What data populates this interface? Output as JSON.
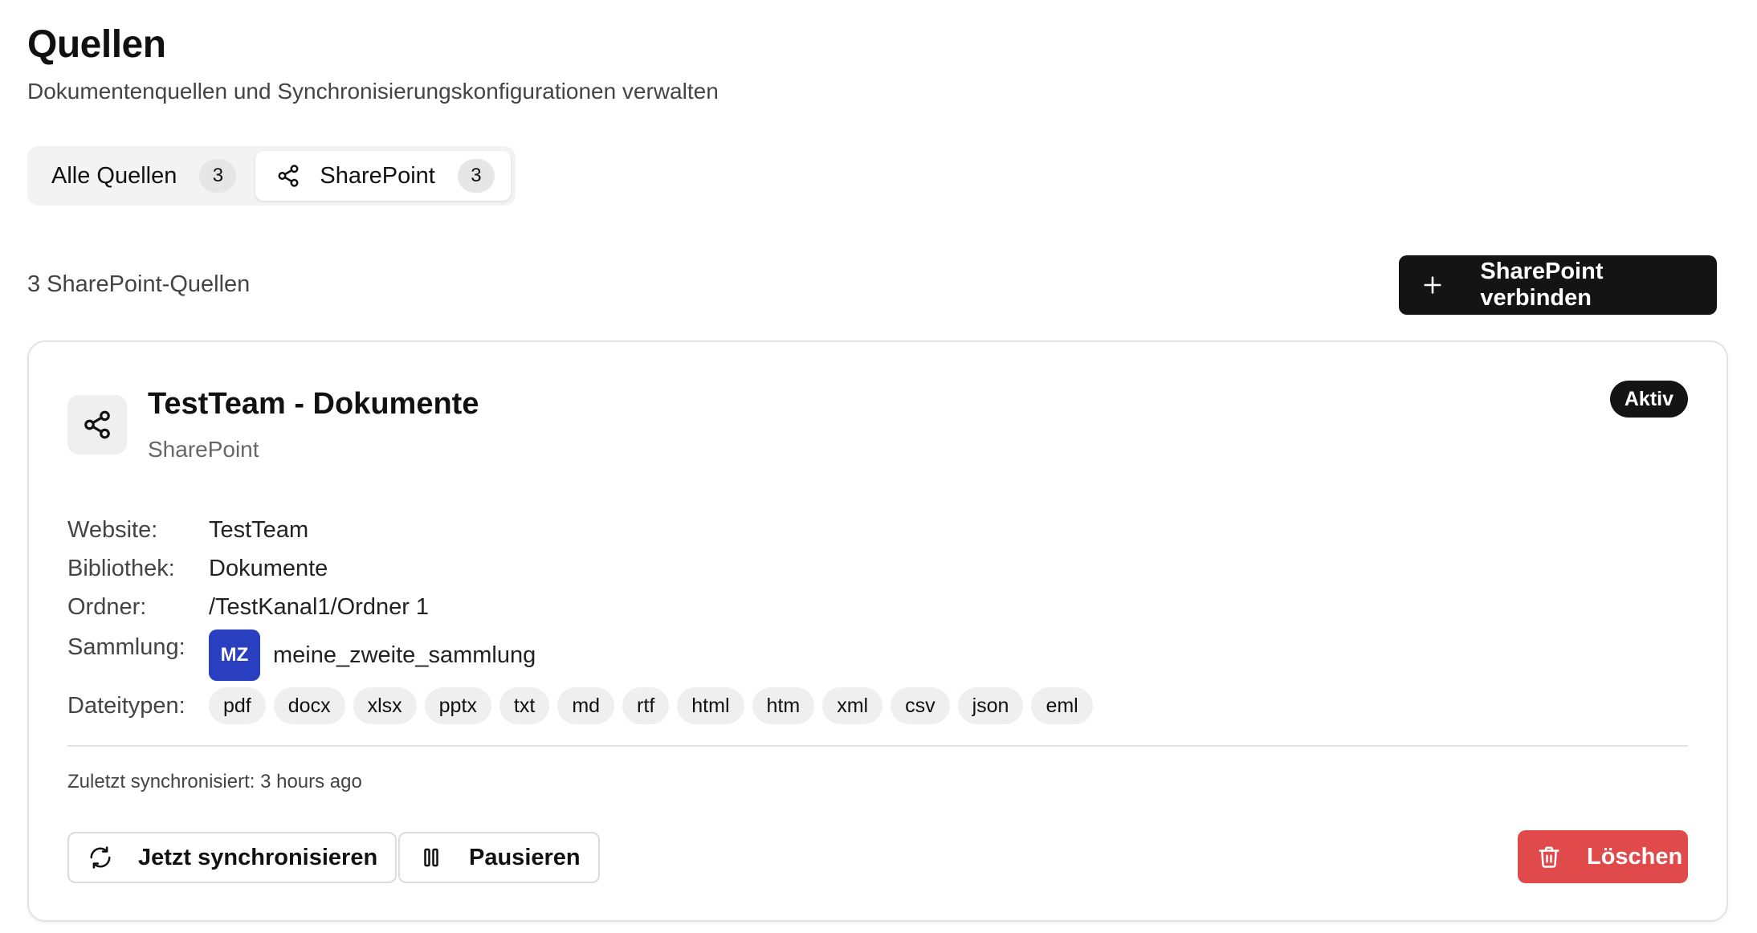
{
  "header": {
    "title": "Quellen",
    "subtitle": "Dokumentenquellen und Synchronisierungskonfigurationen verwalten"
  },
  "tabs": [
    {
      "label": "Alle Quellen",
      "count": "3",
      "active": false
    },
    {
      "label": "SharePoint",
      "count": "3",
      "active": true,
      "icon": "share-icon"
    }
  ],
  "toolbar": {
    "count_label": "3 SharePoint-Quellen",
    "connect_label": "SharePoint verbinden",
    "connect_icon": "plus-icon"
  },
  "source": {
    "title": "TestTeam - Dokumente",
    "type": "SharePoint",
    "icon": "share-icon",
    "status": "Aktiv",
    "details": {
      "website_label": "Website:",
      "website_value": "TestTeam",
      "library_label": "Bibliothek:",
      "library_value": "Dokumente",
      "folder_label": "Ordner:",
      "folder_value": "/TestKanal1/Ordner 1",
      "collection_label": "Sammlung:",
      "collection_initials": "MZ",
      "collection_value": "meine_zweite_sammlung",
      "collection_color": "#2a3fbf",
      "filetypes_label": "Dateitypen:",
      "filetypes": [
        "pdf",
        "docx",
        "xlsx",
        "pptx",
        "txt",
        "md",
        "rtf",
        "html",
        "htm",
        "xml",
        "csv",
        "json",
        "eml"
      ]
    },
    "last_sync": "Zuletzt synchronisiert: 3 hours ago",
    "actions": {
      "sync_label": "Jetzt synchronisieren",
      "pause_label": "Pausieren",
      "delete_label": "Löschen",
      "delete_color": "#e04a4a"
    }
  }
}
